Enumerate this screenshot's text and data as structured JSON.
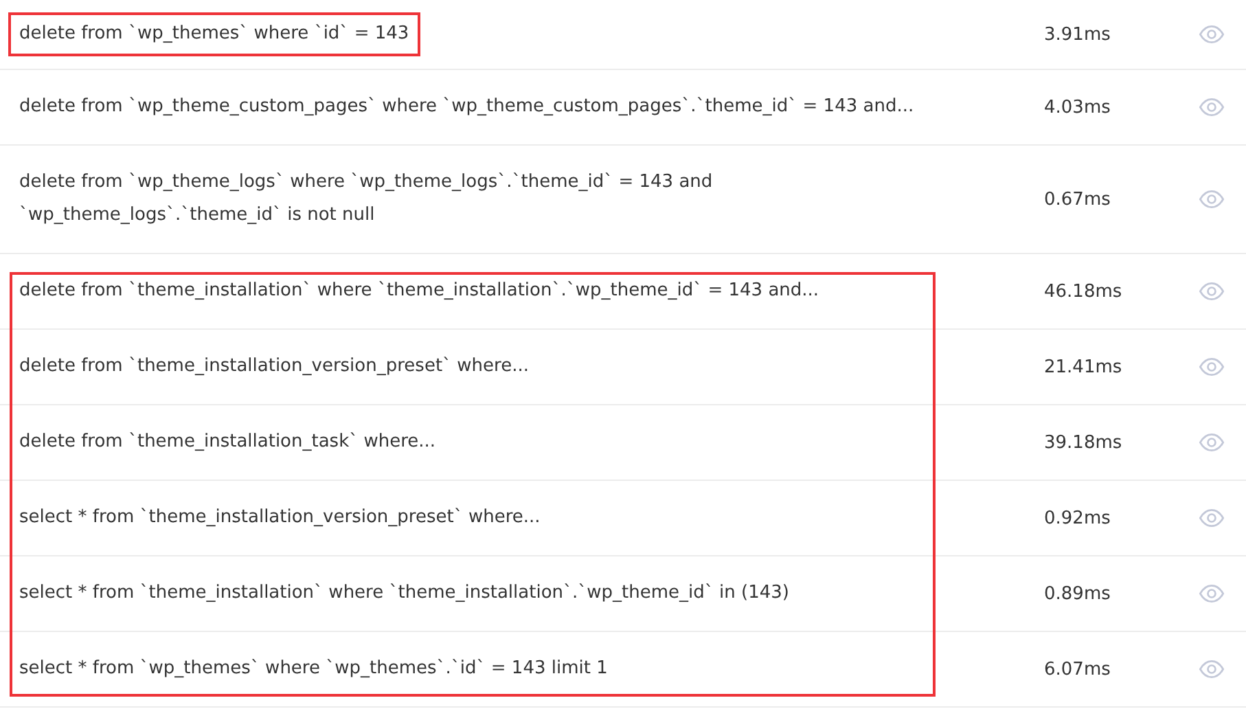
{
  "groups": [
    {
      "highlighted": true,
      "rows": [
        {
          "query": "delete from `wp_themes` where `id` = 143",
          "time": "3.91ms"
        }
      ]
    },
    {
      "highlighted": false,
      "rows": [
        {
          "query": "delete from `wp_theme_custom_pages` where `wp_theme_custom_pages`.`theme_id` = 143 and...",
          "time": "4.03ms"
        },
        {
          "query": "delete from `wp_theme_logs` where `wp_theme_logs`.`theme_id` = 143 and\n`wp_theme_logs`.`theme_id` is not null",
          "time": "0.67ms"
        }
      ]
    },
    {
      "highlighted": true,
      "rows": [
        {
          "query": "delete from `theme_installation` where `theme_installation`.`wp_theme_id` = 143 and...",
          "time": "46.18ms"
        },
        {
          "query": "delete from `theme_installation_version_preset` where...",
          "time": "21.41ms"
        },
        {
          "query": "delete from `theme_installation_task` where...",
          "time": "39.18ms"
        },
        {
          "query": "select * from `theme_installation_version_preset` where...",
          "time": "0.92ms"
        },
        {
          "query": "select * from `theme_installation` where `theme_installation`.`wp_theme_id` in (143)",
          "time": "0.89ms"
        },
        {
          "query": "select * from `wp_themes` where `wp_themes`.`id` = 143 limit 1",
          "time": "6.07ms"
        }
      ]
    }
  ]
}
